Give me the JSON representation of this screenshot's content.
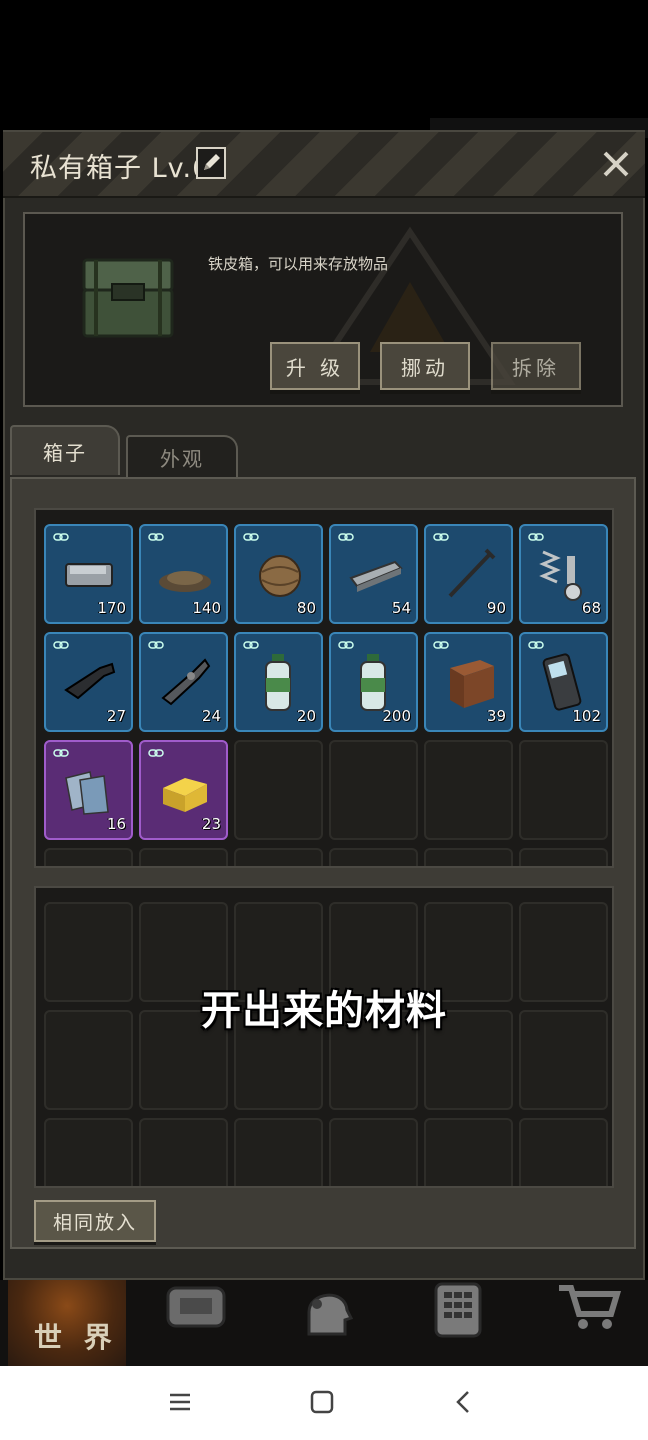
{
  "dialog": {
    "title": "私有箱子 Lv.6",
    "description": "铁皮箱，可以用来存放物品",
    "buttons": {
      "upgrade": "升 级",
      "move": "挪动",
      "dismantle": "拆除"
    }
  },
  "tabs": [
    {
      "label": "箱子",
      "active": true
    },
    {
      "label": "外观",
      "active": false
    }
  ],
  "storage_items": [
    {
      "name": "metal-ingot",
      "count": "170",
      "rarity": "blue"
    },
    {
      "name": "gravel-pile",
      "count": "140",
      "rarity": "blue"
    },
    {
      "name": "rope-ball",
      "count": "80",
      "rarity": "blue"
    },
    {
      "name": "steel-beam",
      "count": "54",
      "rarity": "blue"
    },
    {
      "name": "nail",
      "count": "90",
      "rarity": "blue"
    },
    {
      "name": "spring-and-bolt",
      "count": "68",
      "rarity": "blue"
    },
    {
      "name": "gun-part-a",
      "count": "27",
      "rarity": "blue"
    },
    {
      "name": "gun-part-b",
      "count": "24",
      "rarity": "blue"
    },
    {
      "name": "water-bottle-a",
      "count": "20",
      "rarity": "blue"
    },
    {
      "name": "water-bottle-b",
      "count": "200",
      "rarity": "blue"
    },
    {
      "name": "wood-block",
      "count": "39",
      "rarity": "blue"
    },
    {
      "name": "mobile-phone",
      "count": "102",
      "rarity": "blue"
    },
    {
      "name": "paper-sheets",
      "count": "16",
      "rarity": "purple"
    },
    {
      "name": "gold-block",
      "count": "23",
      "rarity": "purple"
    }
  ],
  "caption": "开出来的材料",
  "same_put_button": "相同放入",
  "bottom_nav": {
    "world_label": "世 界"
  },
  "colors": {
    "slot_blue": "#1d4a6e",
    "slot_purple": "#5a2c75",
    "panel": "#2a2925"
  }
}
